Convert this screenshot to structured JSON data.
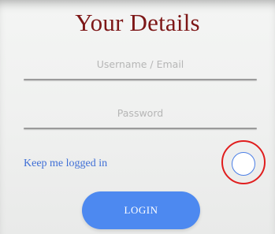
{
  "form": {
    "title": "Your Details",
    "username": {
      "placeholder": "Username / Email",
      "value": ""
    },
    "password": {
      "placeholder": "Password",
      "value": ""
    },
    "keep_logged_in": {
      "label": "Keep me logged in",
      "checked": false
    },
    "login_button": "LOGIN"
  },
  "colors": {
    "title": "#7d1717",
    "link": "#3f6fd6",
    "button": "#4d89f0",
    "highlight": "#e01e1e"
  }
}
